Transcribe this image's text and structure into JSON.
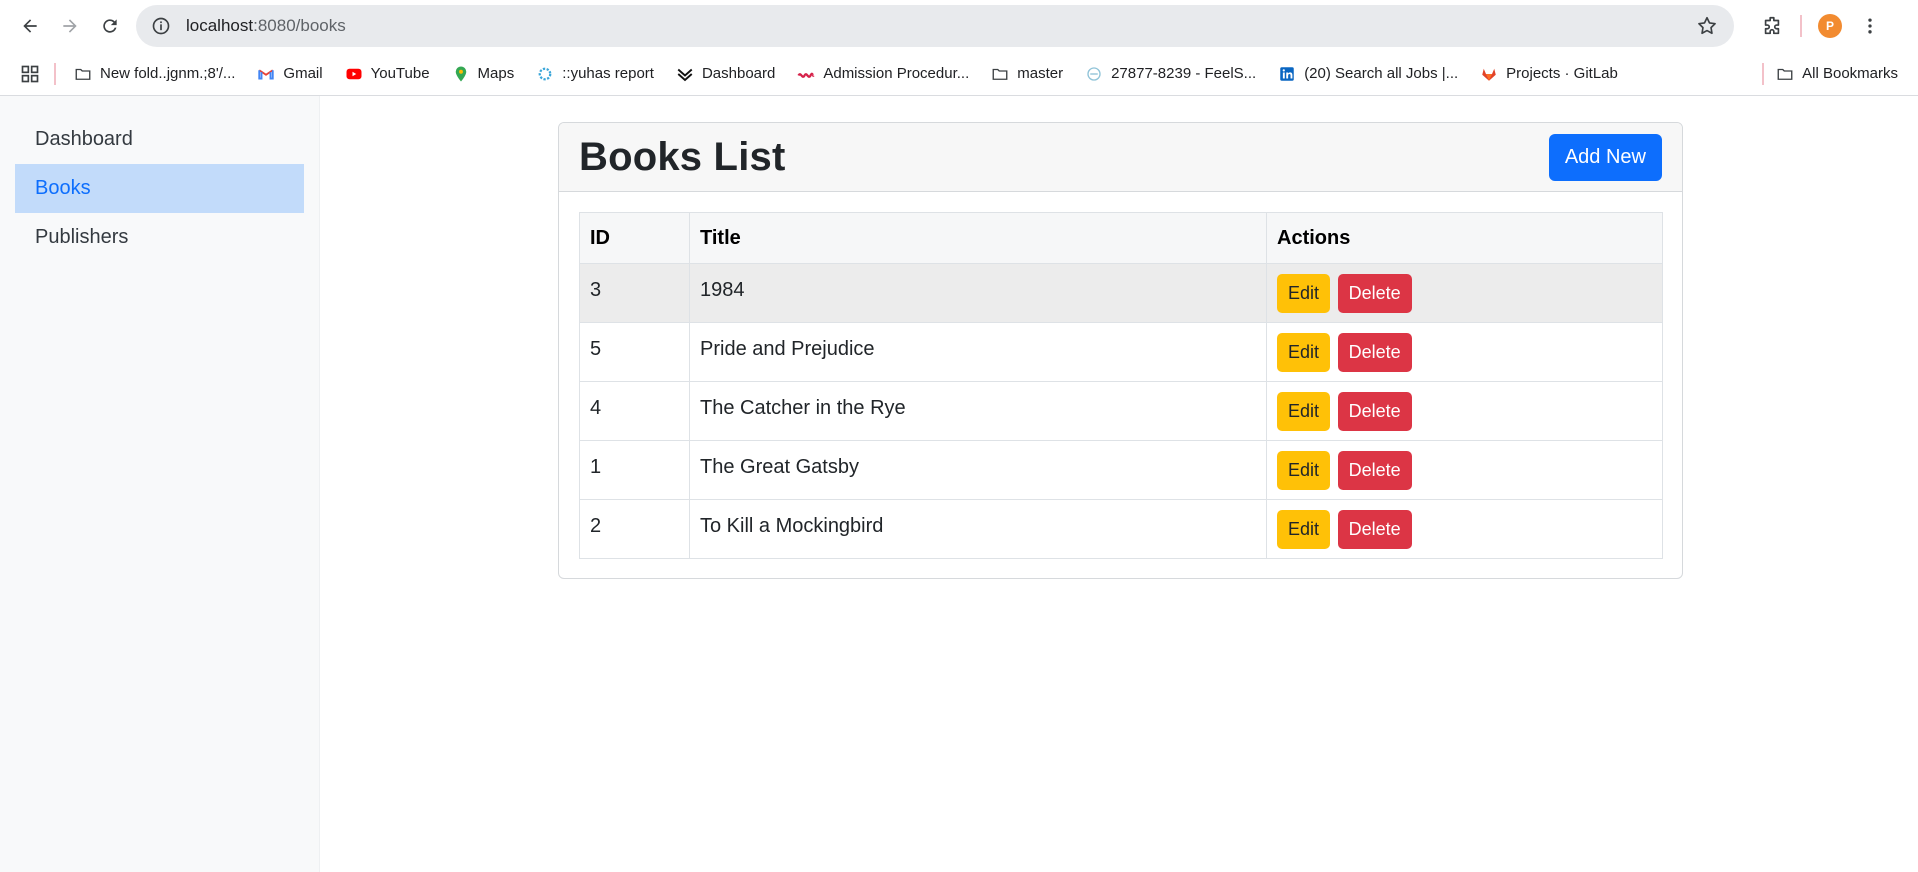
{
  "browser": {
    "url_host": "localhost",
    "url_path": ":8080/books",
    "bookmarks": [
      {
        "label": "New fold..jgnm.;8'/...",
        "icon": "folder-icon"
      },
      {
        "label": "Gmail",
        "icon": "gmail-icon"
      },
      {
        "label": "YouTube",
        "icon": "youtube-icon"
      },
      {
        "label": "Maps",
        "icon": "maps-icon"
      },
      {
        "label": "::yuhas report",
        "icon": "gear-icon"
      },
      {
        "label": "Dashboard",
        "icon": "dashboard-icon"
      },
      {
        "label": "Admission Procedur...",
        "icon": "admission-icon"
      },
      {
        "label": "master",
        "icon": "folder-icon"
      },
      {
        "label": "27877-8239 - FeelS...",
        "icon": "feels-icon"
      },
      {
        "label": "(20) Search all Jobs |...",
        "icon": "linkedin-icon"
      },
      {
        "label": "Projects · GitLab",
        "icon": "gitlab-icon"
      }
    ],
    "all_bookmarks": "All Bookmarks",
    "avatar_letter": "P"
  },
  "sidebar": {
    "items": [
      {
        "label": "Dashboard",
        "active": false
      },
      {
        "label": "Books",
        "active": true
      },
      {
        "label": "Publishers",
        "active": false
      }
    ]
  },
  "card": {
    "title": "Books List",
    "add_button": "Add New"
  },
  "table": {
    "headers": [
      "ID",
      "Title",
      "Actions"
    ],
    "rows": [
      {
        "id": "3",
        "title": "1984"
      },
      {
        "id": "5",
        "title": "Pride and Prejudice"
      },
      {
        "id": "4",
        "title": "The Catcher in the Rye"
      },
      {
        "id": "1",
        "title": "The Great Gatsby"
      },
      {
        "id": "2",
        "title": "To Kill a Mockingbird"
      }
    ],
    "edit_label": "Edit",
    "delete_label": "Delete"
  },
  "colors": {
    "primary": "#0d6efd",
    "warning": "#ffc107",
    "danger": "#dc3545",
    "active_bg": "#c2dbfa"
  }
}
